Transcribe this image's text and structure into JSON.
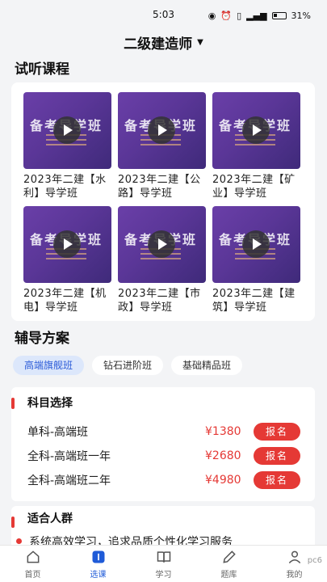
{
  "status_bar": {
    "time": "5:03",
    "battery": "31%"
  },
  "header": {
    "title": "二级建造师"
  },
  "trial_section": {
    "title": "试听课程",
    "thumb_text": "备考导学班",
    "courses": [
      {
        "title": "2023年二建【水利】导学班"
      },
      {
        "title": "2023年二建【公路】导学班"
      },
      {
        "title": "2023年二建【矿业】导学班"
      },
      {
        "title": "2023年二建【机电】导学班"
      },
      {
        "title": "2023年二建【市政】导学班"
      },
      {
        "title": "2023年二建【建筑】导学班"
      }
    ]
  },
  "plan_section": {
    "title": "辅导方案",
    "tabs": [
      "高端旗舰班",
      "钻石进阶班",
      "基础精品班"
    ]
  },
  "subject_card": {
    "title": "科目选择",
    "items": [
      {
        "name": "单科-高端班",
        "price": "¥1380",
        "button": "报名"
      },
      {
        "name": "全科-高端班一年",
        "price": "¥2680",
        "button": "报名"
      },
      {
        "name": "全科-高端班二年",
        "price": "¥4980",
        "button": "报名"
      }
    ]
  },
  "audience_card": {
    "title": "适合人群",
    "text": "系统高效学习，追求品质个性化学习服务"
  },
  "tabbar": {
    "items": [
      {
        "label": "首页",
        "icon": "home-icon"
      },
      {
        "label": "选课",
        "icon": "course-icon"
      },
      {
        "label": "学习",
        "icon": "book-icon"
      },
      {
        "label": "题库",
        "icon": "pencil-icon"
      },
      {
        "label": "我的",
        "icon": "user-icon"
      }
    ],
    "active": "选课"
  },
  "watermark": "pc6"
}
